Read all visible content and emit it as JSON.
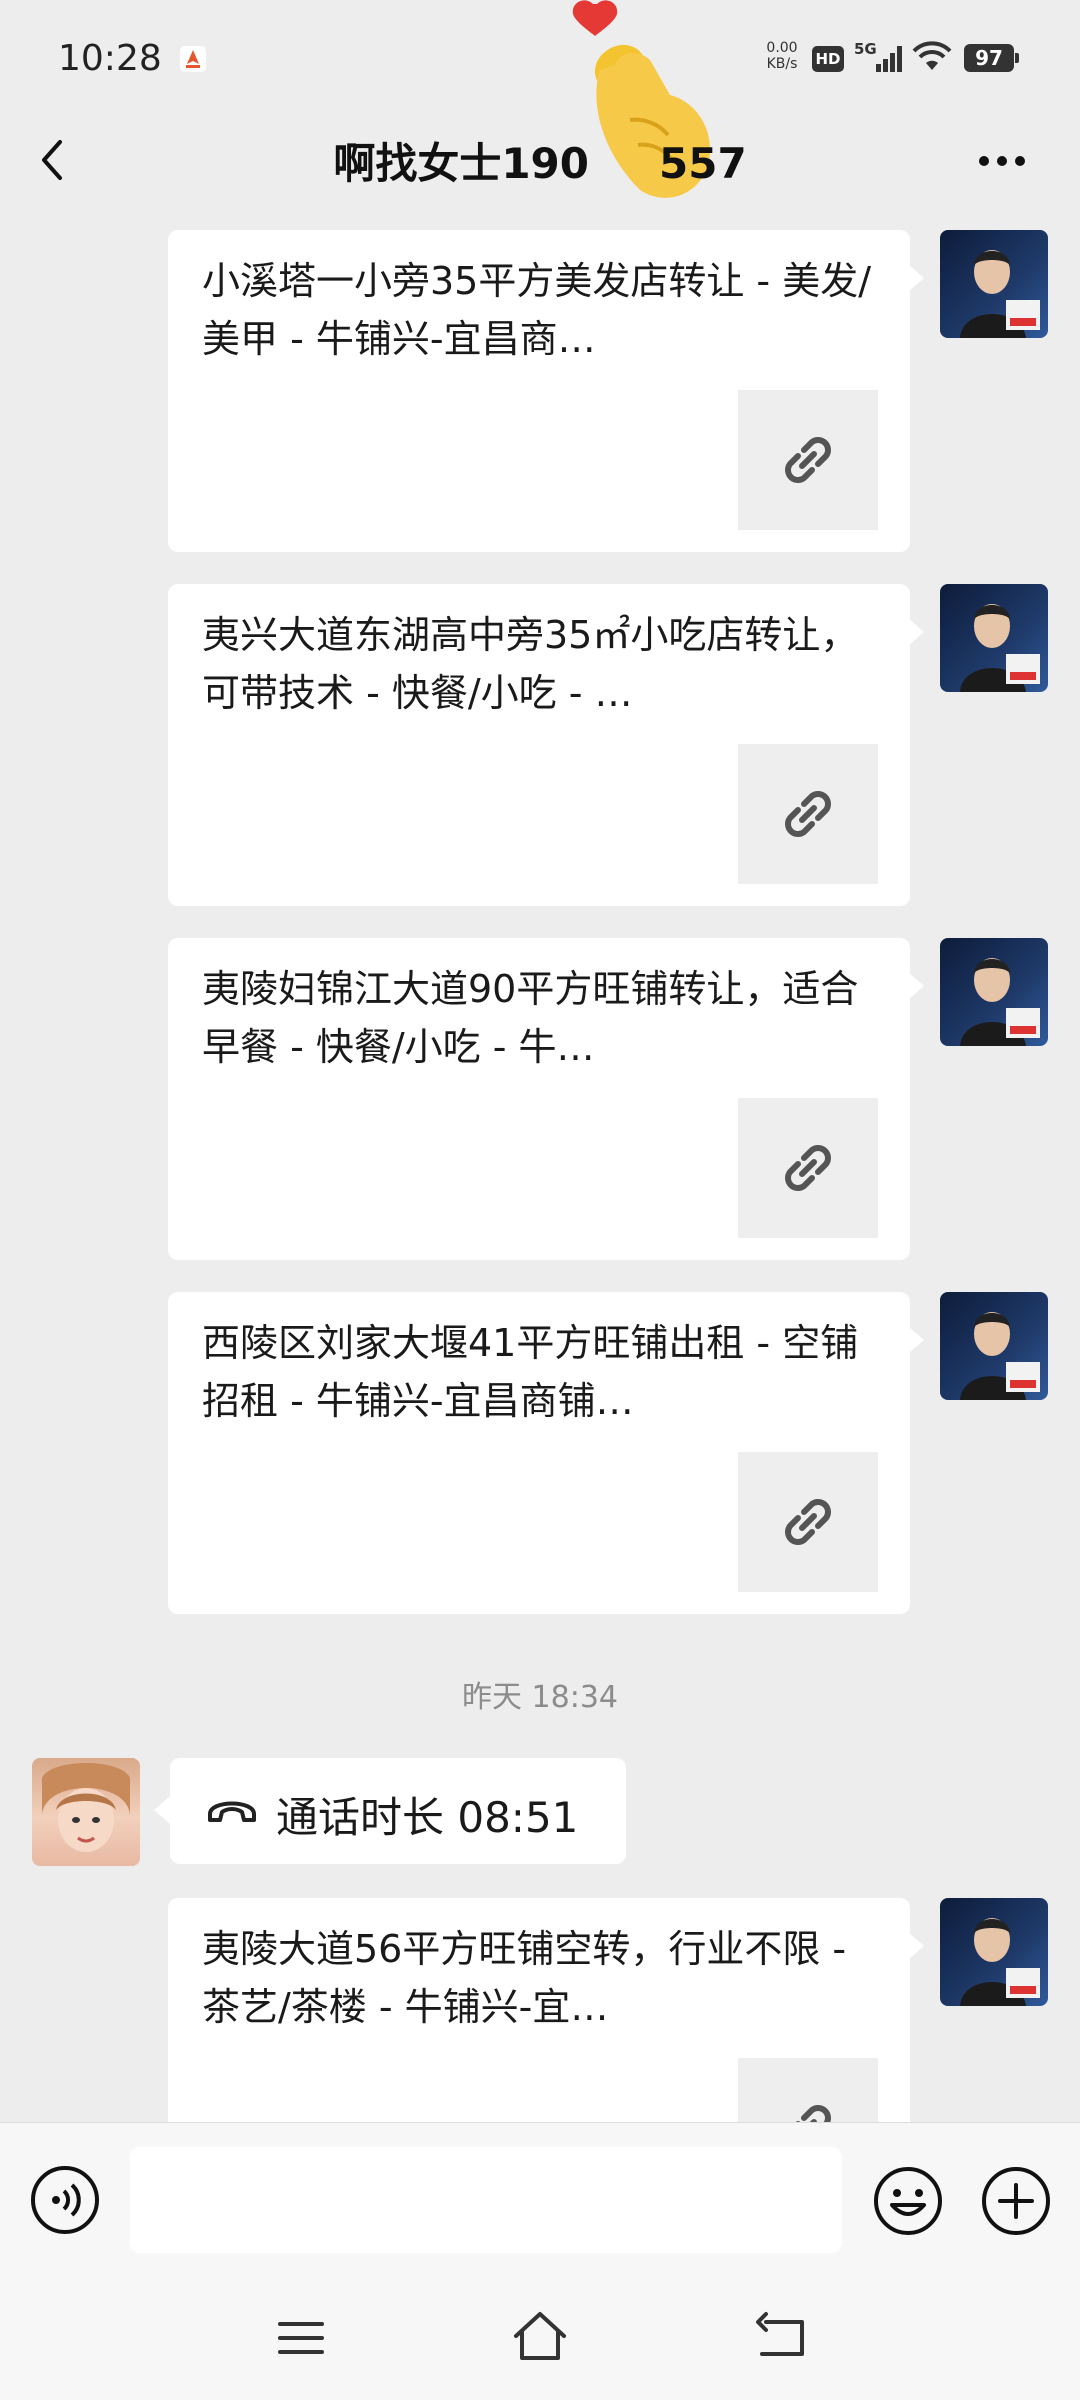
{
  "status_bar": {
    "time": "10:28",
    "net_speed_value": "0.00",
    "net_speed_unit": "KB/s",
    "hd_label": "HD",
    "network_label": "5G",
    "battery_level": "97"
  },
  "header": {
    "title": "啊找女士190",
    "title_tail": "557"
  },
  "messages": [
    {
      "type": "link_card",
      "sender": "other",
      "text": "小溪塔一小旁35平方美发店转让 - 美发/美甲 - 牛铺兴-宜昌商…"
    },
    {
      "type": "link_card",
      "sender": "other",
      "text": "夷兴大道东湖高中旁35㎡小吃店转让，可带技术 - 快餐/小吃 - …"
    },
    {
      "type": "link_card",
      "sender": "other",
      "text": "夷陵妇锦江大道90平方旺铺转让，适合早餐 - 快餐/小吃 - 牛…"
    },
    {
      "type": "link_card",
      "sender": "other",
      "text": "西陵区刘家大堰41平方旺铺出租 - 空铺招租 - 牛铺兴-宜昌商铺…"
    },
    {
      "type": "timestamp",
      "text": "昨天 18:34"
    },
    {
      "type": "call",
      "sender": "me",
      "text": "通话时长 08:51"
    },
    {
      "type": "link_card",
      "sender": "other",
      "text": "夷陵大道56平方旺铺空转，行业不限 - 茶艺/茶楼 - 牛铺兴-宜…"
    }
  ],
  "input_bar": {
    "placeholder": ""
  },
  "icons": {
    "back": "chevron-left-icon",
    "more": "more-dots-icon",
    "link": "link-icon",
    "voice": "voice-icon",
    "emoji": "emoji-icon",
    "plus": "plus-icon",
    "phone": "phone-icon"
  },
  "colors": {
    "background": "#ededed",
    "bubble": "#ffffff",
    "timestamp": "#8c8c8c"
  }
}
